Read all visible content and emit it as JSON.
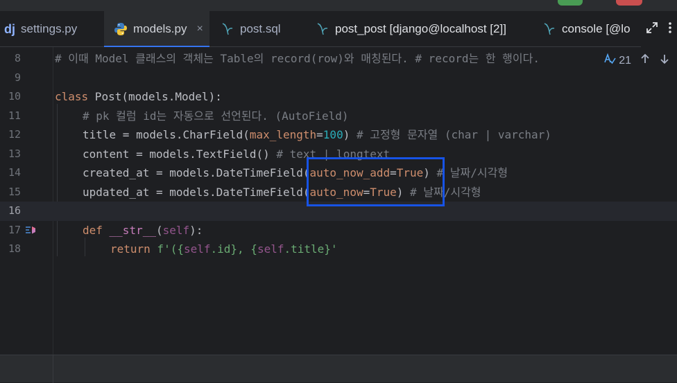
{
  "window": {
    "colors": {
      "accent": "#3574f0",
      "highlight_box": "#1753e6"
    }
  },
  "tabs": [
    {
      "icon": "django-icon",
      "label": "settings.py",
      "active": false
    },
    {
      "icon": "python-icon",
      "label": "models.py",
      "active": true,
      "close": "×"
    },
    {
      "icon": "sql-file-icon",
      "label": "post.sql",
      "active": false
    },
    {
      "icon": "sql-file-icon",
      "label": "post_post [django@localhost [2]]",
      "active": false
    },
    {
      "icon": "sql-file-icon",
      "label": "console [@lo",
      "active": false
    }
  ],
  "django_icon_text": "dj",
  "inspection": {
    "icon": "spellcheck-icon",
    "count": "21"
  },
  "line_numbers": [
    "8",
    "9",
    "10",
    "11",
    "12",
    "13",
    "14",
    "15",
    "16",
    "17",
    "18"
  ],
  "code": {
    "l8": "# 이때 Model 클래스의 객체는 Table의 record(row)와 매칭된다. # record는 한 행이다.",
    "l10_kw": "class",
    "l10_name": " Post(models.Model):",
    "l11": "# pk 컬럼 id는 자동으로 선언된다. (AutoField)",
    "l12_a": "title = models.CharField(",
    "l12_b": "max_length",
    "l12_c": "=",
    "l12_d": "100",
    "l12_e": ") ",
    "l12_f": "# 고정형 문자열 (char | varchar)",
    "l13_a": "content = models.TextField() ",
    "l13_b": "# text | longtext",
    "l14_a": "created_at = models.DateTimeField(",
    "l14_b": "auto_now_add",
    "l14_c": "=",
    "l14_d": "True",
    "l14_e": ") ",
    "l14_f": "# 날짜/시각형",
    "l15_a": "updated_at = models.DateTimeField(",
    "l15_b": "auto_now",
    "l15_c": "=",
    "l15_d": "True",
    "l15_e": ") ",
    "l15_f": "# 날짜/시각형",
    "l17_kw": "def",
    "l17_fn": " __str__",
    "l17_p1": "(",
    "l17_self": "self",
    "l17_p2": "):",
    "l18_kw": "return",
    "l18_s1": " f'({",
    "l18_self1": "self",
    "l18_s2": ".id}, {",
    "l18_self2": "self",
    "l18_s3": ".title}'"
  }
}
